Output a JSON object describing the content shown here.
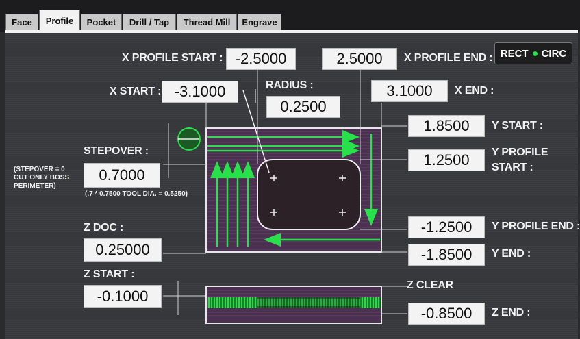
{
  "tabs": [
    "Face",
    "Profile",
    "Pocket",
    "Drill / Tap",
    "Thread Mill",
    "Engrave"
  ],
  "active_tab": "Profile",
  "shape_toggle": {
    "left": "RECT",
    "right": "CIRC"
  },
  "x_profile_start": {
    "label": "X PROFILE START :",
    "value": "-2.5000"
  },
  "x_profile_end": {
    "label": "X PROFILE END :",
    "value": "2.5000"
  },
  "x_start": {
    "label": "X START :",
    "value": "-3.1000"
  },
  "x_end": {
    "label": "X END :",
    "value": "3.1000"
  },
  "radius": {
    "label": "RADIUS :",
    "value": "0.2500"
  },
  "y_start": {
    "label": "Y START :",
    "value": "1.8500"
  },
  "y_profile_start": {
    "label_line1": "Y PROFILE",
    "label_line2": "START :",
    "value": "1.2500"
  },
  "y_profile_end": {
    "label": "Y PROFILE END :",
    "value": "-1.2500"
  },
  "y_end": {
    "label": "Y END :",
    "value": "-1.8500"
  },
  "stepover": {
    "label": "STEPOVER :",
    "value": "0.7000",
    "note": "(.7 * 0.7500 TOOL DIA. = 0.5250)",
    "side_note": [
      "(STEPOVER = 0",
      "CUT ONLY BOSS",
      "PERIMETER)"
    ]
  },
  "z_doc": {
    "label": "Z DOC :",
    "value": "0.25000"
  },
  "z_start": {
    "label": "Z START :",
    "value": "-0.1000"
  },
  "z_clear": {
    "label": "Z CLEAR"
  },
  "z_end": {
    "label": "Z END :",
    "value": "-0.8500"
  },
  "colors": {
    "toolpath": "#27e04a",
    "stock": "#4a3150",
    "panel": "#37383b"
  }
}
